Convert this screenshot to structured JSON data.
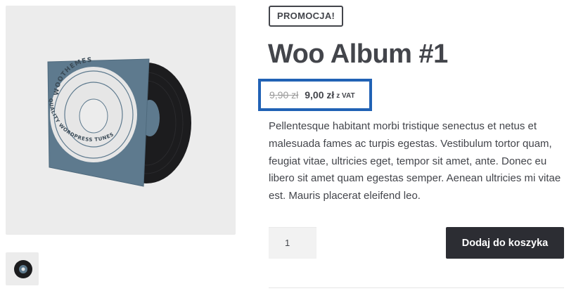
{
  "product": {
    "title": "Woo Album #1",
    "badge": "PROMOCJA!",
    "price_old": "9,90 zł",
    "price_new": "9,00 zł",
    "price_suffix": "z VAT",
    "description": "Pellentesque habitant morbi tristique senectus et netus et malesuada fames ac turpis egestas. Vestibulum tortor quam, feugiat vitae, ultricies eget, tempor sit amet, ante. Donec eu libero sit amet quam egestas semper. Aenean ultricies mi vitae est. Mauris placerat eleifend leo."
  },
  "image": {
    "brand_text": "WOOTHEMES",
    "tagline_text": "QUALITY WORDPRESS TUNES",
    "sleeve_color": "#5e7a8e",
    "record_color": "#1c1c1e",
    "icon": "album-cover-icon"
  },
  "cart": {
    "quantity": "1",
    "button_label": "Dodaj do koszyka"
  },
  "colors": {
    "highlight_border": "#2162b5",
    "button_bg": "#2c2d33",
    "text": "#43454b"
  }
}
